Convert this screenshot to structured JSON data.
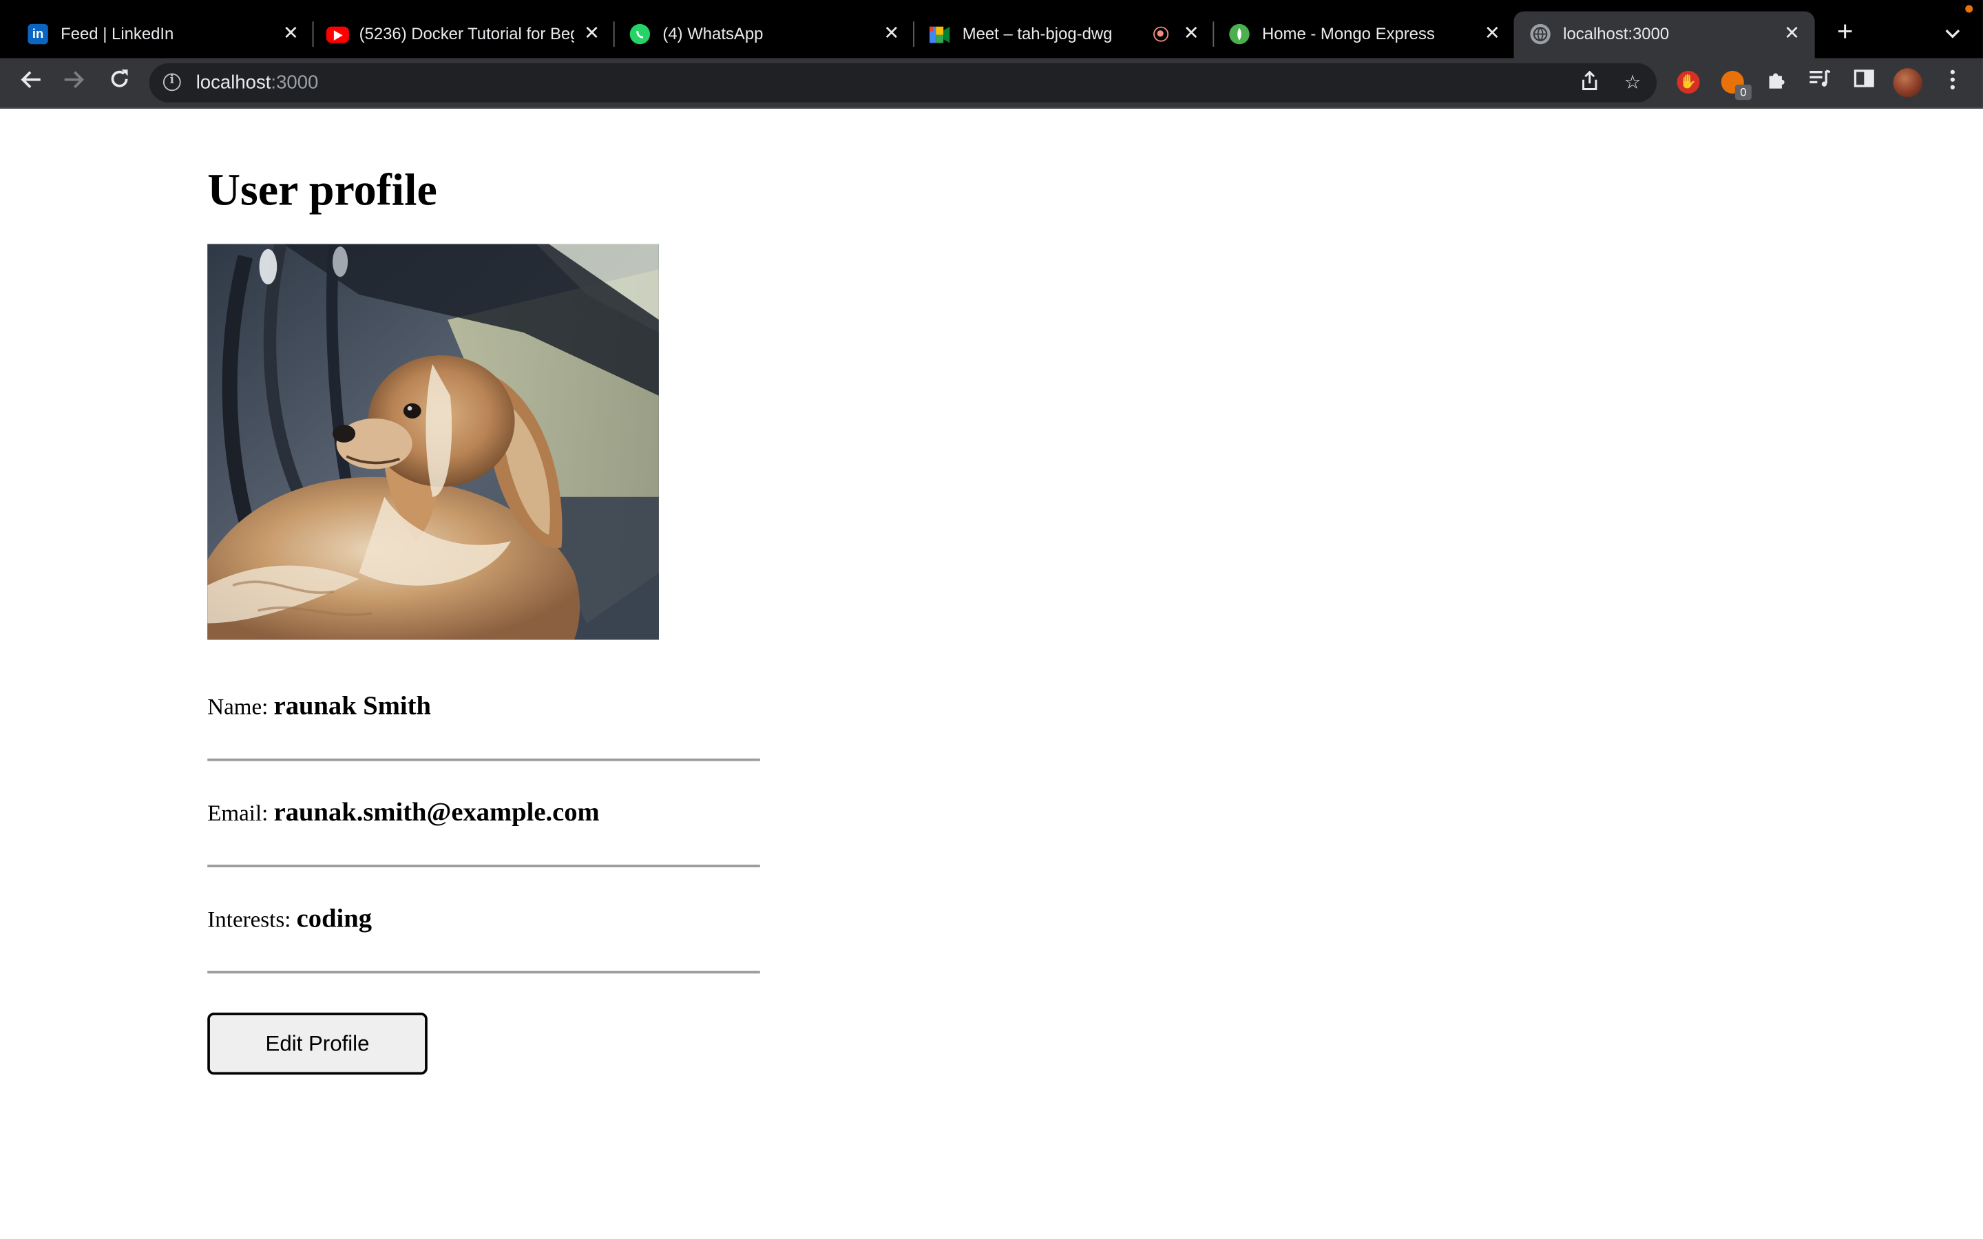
{
  "browser": {
    "tabs": [
      {
        "title": "Feed | LinkedIn",
        "icon": "linkedin-icon",
        "color": "#0a66c2"
      },
      {
        "title": "(5236) Docker Tutorial for Beginners",
        "icon": "youtube-icon",
        "color": "#ff0000"
      },
      {
        "title": "(4) WhatsApp",
        "icon": "whatsapp-icon",
        "color": "#25d366"
      },
      {
        "title": "Meet – tah-bjog-dwg",
        "icon": "google-meet-icon",
        "color": "#00832d"
      },
      {
        "title": "Home - Mongo Express",
        "icon": "mongo-icon",
        "color": "#4caf50"
      },
      {
        "title": "localhost:3000",
        "icon": "globe-icon",
        "color": "#9aa0a6"
      }
    ],
    "address": {
      "host": "localhost",
      "port": ":3000"
    },
    "extension_badge": "0"
  },
  "page": {
    "title": "User profile",
    "photo_icon": "dog-photo",
    "fields": [
      {
        "label": "Name:",
        "value": "raunak Smith"
      },
      {
        "label": "Email:",
        "value": "raunak.smith@example.com"
      },
      {
        "label": "Interests:",
        "value": "coding"
      }
    ],
    "edit_button": "Edit Profile"
  }
}
